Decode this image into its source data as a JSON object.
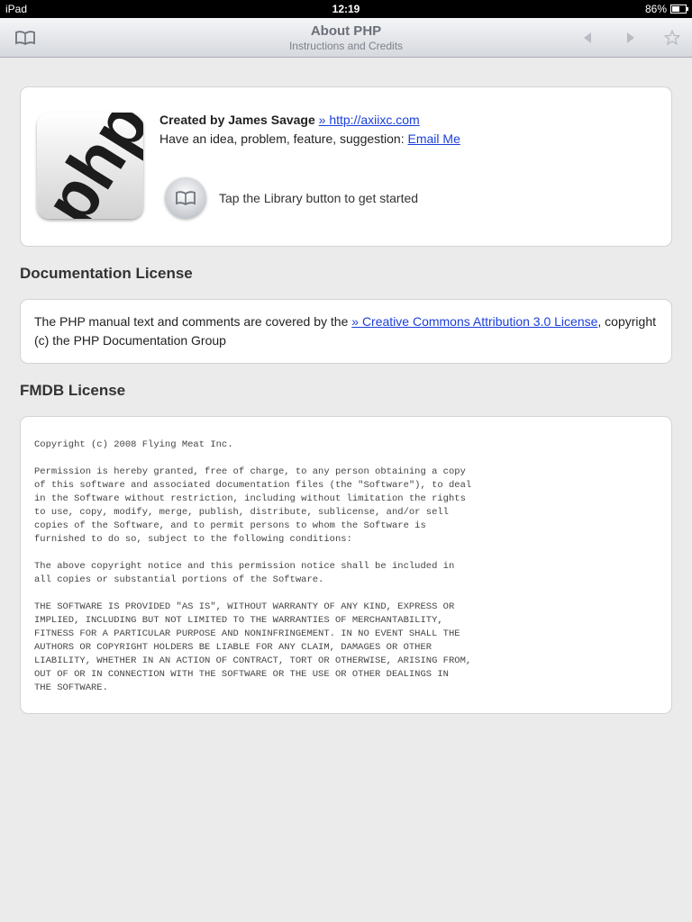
{
  "status_bar": {
    "carrier": "iPad",
    "time": "12:19",
    "battery": "86%"
  },
  "toolbar": {
    "title": "About PHP",
    "subtitle": "Instructions and Credits"
  },
  "intro": {
    "created_by": "Created by James Savage",
    "site_link": "» http://axiixc.com",
    "idea_prompt": "Have an idea, problem, feature, suggestion:",
    "email_link": "Email Me",
    "tip": "Tap the Library button to get started",
    "logo_text": "php"
  },
  "doc_license": {
    "heading": "Documentation License",
    "text_before": "The PHP manual text and comments are covered by the",
    "link": "» Creative Commons Attribution 3.0 License",
    "text_after": ", copyright (c) the PHP Documentation Group"
  },
  "fmdb_license": {
    "heading": "FMDB License",
    "text": "Copyright (c) 2008 Flying Meat Inc.\n\nPermission is hereby granted, free of charge, to any person obtaining a copy\nof this software and associated documentation files (the \"Software\"), to deal\nin the Software without restriction, including without limitation the rights\nto use, copy, modify, merge, publish, distribute, sublicense, and/or sell\ncopies of the Software, and to permit persons to whom the Software is\nfurnished to do so, subject to the following conditions:\n\nThe above copyright notice and this permission notice shall be included in\nall copies or substantial portions of the Software.\n\nTHE SOFTWARE IS PROVIDED \"AS IS\", WITHOUT WARRANTY OF ANY KIND, EXPRESS OR\nIMPLIED, INCLUDING BUT NOT LIMITED TO THE WARRANTIES OF MERCHANTABILITY,\nFITNESS FOR A PARTICULAR PURPOSE AND NONINFRINGEMENT. IN NO EVENT SHALL THE\nAUTHORS OR COPYRIGHT HOLDERS BE LIABLE FOR ANY CLAIM, DAMAGES OR OTHER\nLIABILITY, WHETHER IN AN ACTION OF CONTRACT, TORT OR OTHERWISE, ARISING FROM,\nOUT OF OR IN CONNECTION WITH THE SOFTWARE OR THE USE OR OTHER DEALINGS IN\nTHE SOFTWARE."
  },
  "icons": {
    "library": "book-icon",
    "back": "back-arrow-icon",
    "forward": "forward-arrow-icon",
    "bookmark": "star-icon"
  },
  "colors": {
    "link": "#1a3fd9",
    "background": "#ebebeb",
    "toolbar_text": "#6b7078"
  }
}
